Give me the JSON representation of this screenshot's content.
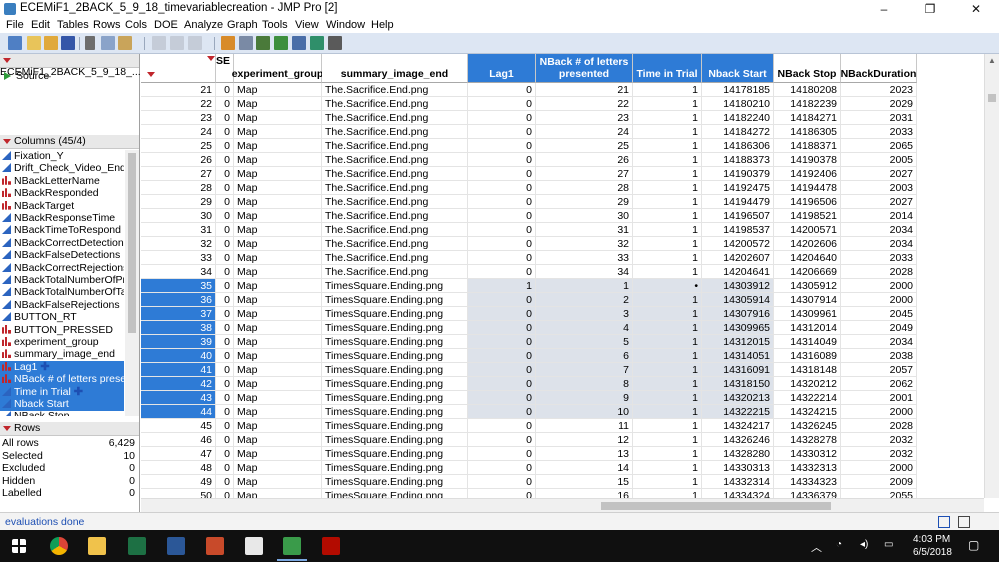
{
  "window": {
    "title": "ECEMiF1_2BACK_5_9_18_timevariablecreation - JMP Pro [2]",
    "controls": [
      "–",
      "❐",
      "✕"
    ]
  },
  "menu": [
    "File",
    "Edit",
    "Tables",
    "Rows",
    "Cols",
    "DOE",
    "Analyze",
    "Graph",
    "Tools",
    "View",
    "Window",
    "Help"
  ],
  "table_panel": {
    "name": "ECEMiF1_2BACK_5_9_18_...",
    "source_label": "Source"
  },
  "columns_panel": {
    "header": "Columns (45/4)",
    "items": [
      {
        "label": "Fixation_Y",
        "type": "cont",
        "selected": false
      },
      {
        "label": "Drift_Check_Video_End_Exp",
        "type": "cont",
        "selected": false
      },
      {
        "label": "NBackLetterName",
        "type": "nom",
        "selected": false
      },
      {
        "label": "NBackResponded",
        "type": "nom",
        "selected": false
      },
      {
        "label": "NBackTarget",
        "type": "nom",
        "selected": false
      },
      {
        "label": "NBackResponseTime",
        "type": "cont",
        "selected": false
      },
      {
        "label": "NBackTimeToRespond",
        "type": "cont",
        "selected": false
      },
      {
        "label": "NBackCorrectDetections",
        "type": "cont",
        "selected": false
      },
      {
        "label": "NBackFalseDetections",
        "type": "cont",
        "selected": false
      },
      {
        "label": "NBackCorrectRejections",
        "type": "cont",
        "selected": false
      },
      {
        "label": "NBackTotalNumberOfPresentations",
        "type": "cont",
        "selected": false
      },
      {
        "label": "NBackTotalNumberOfTargets",
        "type": "cont",
        "selected": false
      },
      {
        "label": "NBackFalseRejections",
        "type": "cont",
        "selected": false
      },
      {
        "label": "BUTTON_RT",
        "type": "cont",
        "selected": false
      },
      {
        "label": "BUTTON_PRESSED",
        "type": "nom",
        "selected": false
      },
      {
        "label": "experiment_group",
        "type": "nom",
        "selected": false
      },
      {
        "label": "summary_image_end",
        "type": "nom",
        "selected": false
      },
      {
        "label": "Lag1",
        "type": "nom",
        "selected": true,
        "plus": true
      },
      {
        "label": "NBack # of letters presented",
        "type": "nom",
        "selected": true,
        "plus": false
      },
      {
        "label": "Time in Trial",
        "type": "cont",
        "selected": true,
        "plus": true
      },
      {
        "label": "Nback Start",
        "type": "cont",
        "selected": true,
        "plus": false
      },
      {
        "label": "NBack Stop",
        "type": "cont",
        "selected": false
      }
    ]
  },
  "rows_panel": {
    "header": "Rows",
    "stats": [
      {
        "label": "All rows",
        "value": "6,429"
      },
      {
        "label": "Selected",
        "value": "10"
      },
      {
        "label": "Excluded",
        "value": "0"
      },
      {
        "label": "Hidden",
        "value": "0"
      },
      {
        "label": "Labelled",
        "value": "0"
      }
    ]
  },
  "grid": {
    "partial_header": "SE",
    "headers": [
      "experiment_group",
      "summary_image_end",
      "Lag1",
      "NBack # of letters presented",
      "Time in Trial",
      "Nback Start",
      "NBack Stop",
      "NBackDuration"
    ],
    "selected_headers": [
      2,
      3,
      4,
      5
    ],
    "rows": [
      {
        "n": "21",
        "se": "0",
        "group": "Map",
        "image": "The.Sacrifice.End.png",
        "lag1": "0",
        "letters": "21",
        "time": "1",
        "start": "14178185",
        "stop": "14180208",
        "dur": "2023",
        "sel": false
      },
      {
        "n": "22",
        "se": "0",
        "group": "Map",
        "image": "The.Sacrifice.End.png",
        "lag1": "0",
        "letters": "22",
        "time": "1",
        "start": "14180210",
        "stop": "14182239",
        "dur": "2029",
        "sel": false
      },
      {
        "n": "23",
        "se": "0",
        "group": "Map",
        "image": "The.Sacrifice.End.png",
        "lag1": "0",
        "letters": "23",
        "time": "1",
        "start": "14182240",
        "stop": "14184271",
        "dur": "2031",
        "sel": false
      },
      {
        "n": "24",
        "se": "0",
        "group": "Map",
        "image": "The.Sacrifice.End.png",
        "lag1": "0",
        "letters": "24",
        "time": "1",
        "start": "14184272",
        "stop": "14186305",
        "dur": "2033",
        "sel": false
      },
      {
        "n": "25",
        "se": "0",
        "group": "Map",
        "image": "The.Sacrifice.End.png",
        "lag1": "0",
        "letters": "25",
        "time": "1",
        "start": "14186306",
        "stop": "14188371",
        "dur": "2065",
        "sel": false
      },
      {
        "n": "26",
        "se": "0",
        "group": "Map",
        "image": "The.Sacrifice.End.png",
        "lag1": "0",
        "letters": "26",
        "time": "1",
        "start": "14188373",
        "stop": "14190378",
        "dur": "2005",
        "sel": false
      },
      {
        "n": "27",
        "se": "0",
        "group": "Map",
        "image": "The.Sacrifice.End.png",
        "lag1": "0",
        "letters": "27",
        "time": "1",
        "start": "14190379",
        "stop": "14192406",
        "dur": "2027",
        "sel": false
      },
      {
        "n": "28",
        "se": "0",
        "group": "Map",
        "image": "The.Sacrifice.End.png",
        "lag1": "0",
        "letters": "28",
        "time": "1",
        "start": "14192475",
        "stop": "14194478",
        "dur": "2003",
        "sel": false
      },
      {
        "n": "29",
        "se": "0",
        "group": "Map",
        "image": "The.Sacrifice.End.png",
        "lag1": "0",
        "letters": "29",
        "time": "1",
        "start": "14194479",
        "stop": "14196506",
        "dur": "2027",
        "sel": false
      },
      {
        "n": "30",
        "se": "0",
        "group": "Map",
        "image": "The.Sacrifice.End.png",
        "lag1": "0",
        "letters": "30",
        "time": "1",
        "start": "14196507",
        "stop": "14198521",
        "dur": "2014",
        "sel": false
      },
      {
        "n": "31",
        "se": "0",
        "group": "Map",
        "image": "The.Sacrifice.End.png",
        "lag1": "0",
        "letters": "31",
        "time": "1",
        "start": "14198537",
        "stop": "14200571",
        "dur": "2034",
        "sel": false
      },
      {
        "n": "32",
        "se": "0",
        "group": "Map",
        "image": "The.Sacrifice.End.png",
        "lag1": "0",
        "letters": "32",
        "time": "1",
        "start": "14200572",
        "stop": "14202606",
        "dur": "2034",
        "sel": false
      },
      {
        "n": "33",
        "se": "0",
        "group": "Map",
        "image": "The.Sacrifice.End.png",
        "lag1": "0",
        "letters": "33",
        "time": "1",
        "start": "14202607",
        "stop": "14204640",
        "dur": "2033",
        "sel": false
      },
      {
        "n": "34",
        "se": "0",
        "group": "Map",
        "image": "The.Sacrifice.End.png",
        "lag1": "0",
        "letters": "34",
        "time": "1",
        "start": "14204641",
        "stop": "14206669",
        "dur": "2028",
        "sel": false
      },
      {
        "n": "35",
        "se": "0",
        "group": "Map",
        "image": "TimesSquare.Ending.png",
        "lag1": "1",
        "letters": "1",
        "time": "•",
        "start": "14303912",
        "stop": "14305912",
        "dur": "2000",
        "sel": true
      },
      {
        "n": "36",
        "se": "0",
        "group": "Map",
        "image": "TimesSquare.Ending.png",
        "lag1": "0",
        "letters": "2",
        "time": "1",
        "start": "14305914",
        "stop": "14307914",
        "dur": "2000",
        "sel": true
      },
      {
        "n": "37",
        "se": "0",
        "group": "Map",
        "image": "TimesSquare.Ending.png",
        "lag1": "0",
        "letters": "3",
        "time": "1",
        "start": "14307916",
        "stop": "14309961",
        "dur": "2045",
        "sel": true
      },
      {
        "n": "38",
        "se": "0",
        "group": "Map",
        "image": "TimesSquare.Ending.png",
        "lag1": "0",
        "letters": "4",
        "time": "1",
        "start": "14309965",
        "stop": "14312014",
        "dur": "2049",
        "sel": true
      },
      {
        "n": "39",
        "se": "0",
        "group": "Map",
        "image": "TimesSquare.Ending.png",
        "lag1": "0",
        "letters": "5",
        "time": "1",
        "start": "14312015",
        "stop": "14314049",
        "dur": "2034",
        "sel": true
      },
      {
        "n": "40",
        "se": "0",
        "group": "Map",
        "image": "TimesSquare.Ending.png",
        "lag1": "0",
        "letters": "6",
        "time": "1",
        "start": "14314051",
        "stop": "14316089",
        "dur": "2038",
        "sel": true
      },
      {
        "n": "41",
        "se": "0",
        "group": "Map",
        "image": "TimesSquare.Ending.png",
        "lag1": "0",
        "letters": "7",
        "time": "1",
        "start": "14316091",
        "stop": "14318148",
        "dur": "2057",
        "sel": true
      },
      {
        "n": "42",
        "se": "0",
        "group": "Map",
        "image": "TimesSquare.Ending.png",
        "lag1": "0",
        "letters": "8",
        "time": "1",
        "start": "14318150",
        "stop": "14320212",
        "dur": "2062",
        "sel": true
      },
      {
        "n": "43",
        "se": "0",
        "group": "Map",
        "image": "TimesSquare.Ending.png",
        "lag1": "0",
        "letters": "9",
        "time": "1",
        "start": "14320213",
        "stop": "14322214",
        "dur": "2001",
        "sel": true
      },
      {
        "n": "44",
        "se": "0",
        "group": "Map",
        "image": "TimesSquare.Ending.png",
        "lag1": "0",
        "letters": "10",
        "time": "1",
        "start": "14322215",
        "stop": "14324215",
        "dur": "2000",
        "sel": true
      },
      {
        "n": "45",
        "se": "0",
        "group": "Map",
        "image": "TimesSquare.Ending.png",
        "lag1": "0",
        "letters": "11",
        "time": "1",
        "start": "14324217",
        "stop": "14326245",
        "dur": "2028",
        "sel": false
      },
      {
        "n": "46",
        "se": "0",
        "group": "Map",
        "image": "TimesSquare.Ending.png",
        "lag1": "0",
        "letters": "12",
        "time": "1",
        "start": "14326246",
        "stop": "14328278",
        "dur": "2032",
        "sel": false
      },
      {
        "n": "47",
        "se": "0",
        "group": "Map",
        "image": "TimesSquare.Ending.png",
        "lag1": "0",
        "letters": "13",
        "time": "1",
        "start": "14328280",
        "stop": "14330312",
        "dur": "2032",
        "sel": false
      },
      {
        "n": "48",
        "se": "0",
        "group": "Map",
        "image": "TimesSquare.Ending.png",
        "lag1": "0",
        "letters": "14",
        "time": "1",
        "start": "14330313",
        "stop": "14332313",
        "dur": "2000",
        "sel": false
      },
      {
        "n": "49",
        "se": "0",
        "group": "Map",
        "image": "TimesSquare.Ending.png",
        "lag1": "0",
        "letters": "15",
        "time": "1",
        "start": "14332314",
        "stop": "14334323",
        "dur": "2009",
        "sel": false
      },
      {
        "n": "50",
        "se": "0",
        "group": "Map",
        "image": "TimesSquare.Ending.png",
        "lag1": "0",
        "letters": "16",
        "time": "1",
        "start": "14334324",
        "stop": "14336379",
        "dur": "2055",
        "sel": false
      }
    ]
  },
  "status": {
    "text": "evaluations done"
  },
  "taskbar": {
    "time": "4:03 PM",
    "date": "6/5/2018",
    "apps": [
      "windows-start",
      "chrome",
      "file-explorer",
      "excel",
      "word",
      "powerpoint",
      "snipping-tool",
      "jmp",
      "acrobat"
    ]
  },
  "colors": {
    "selection": "#2e7bd6",
    "highlight_cells": "#dde2ea",
    "toolbar": "#dde6f3",
    "status_text": "#1d4fb3"
  }
}
